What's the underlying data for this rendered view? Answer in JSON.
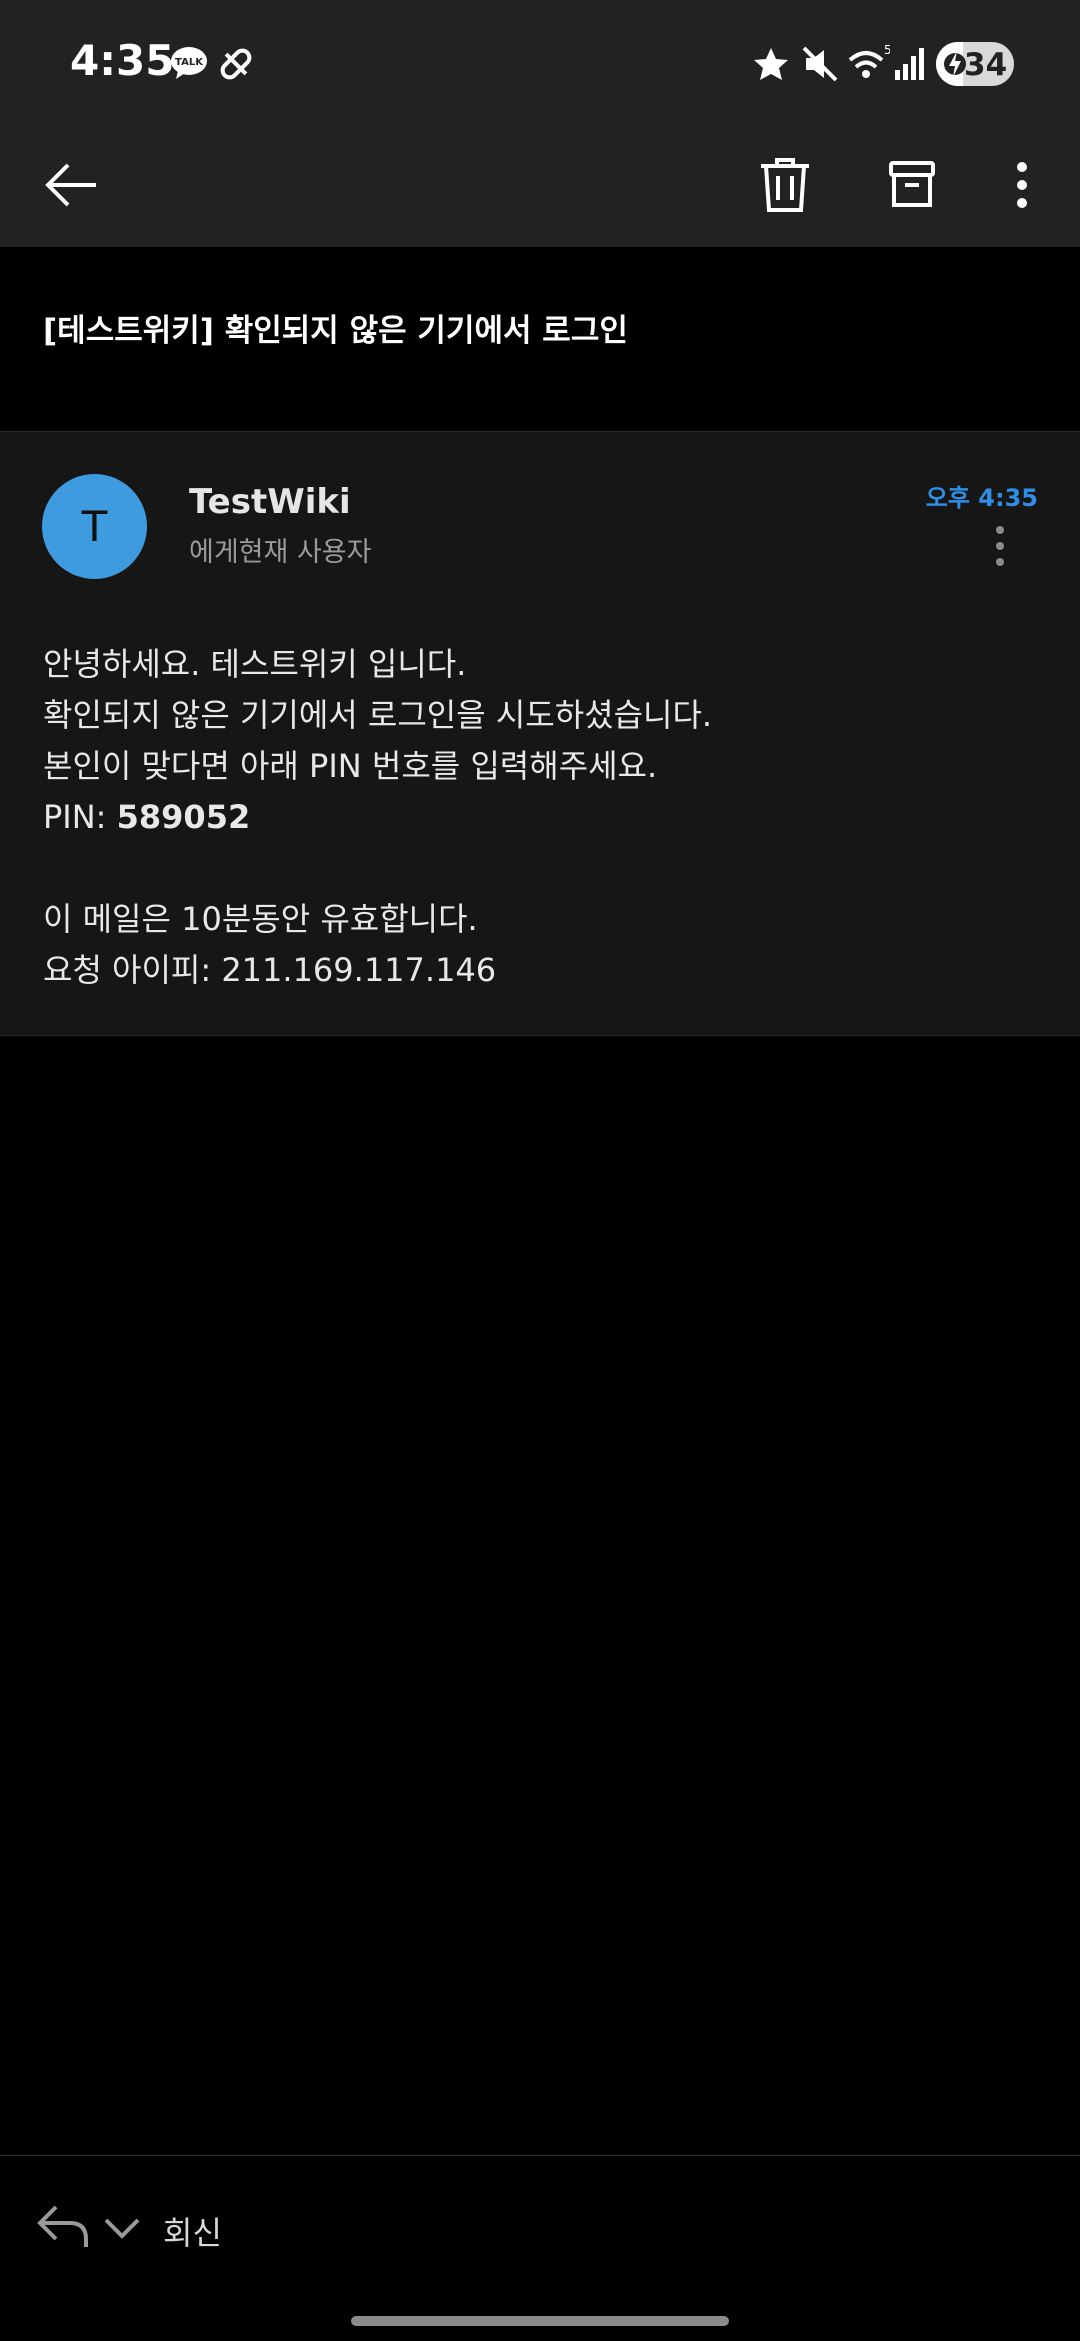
{
  "status_bar": {
    "time": "4:35",
    "notification_icons": [
      "talk-icon",
      "pill-icon"
    ],
    "system_icons": [
      "star-icon",
      "mute-icon",
      "wifi-icon",
      "signal-icon"
    ],
    "battery_percent": "34",
    "charging": true
  },
  "toolbar": {
    "icons": [
      "back-arrow-icon",
      "trash-icon",
      "archive-icon",
      "more-vertical-icon"
    ]
  },
  "email": {
    "subject": "[테스트위키] 확인되지 않은 기기에서 로그인",
    "avatar_letter": "T",
    "sender_name": "TestWiki",
    "recipient": "에게현재 사용자",
    "time": "오후 4:35",
    "body": {
      "line1": "안녕하세요. 테스트위키 입니다.",
      "line2": "확인되지 않은 기기에서 로그인을 시도하셨습니다.",
      "line3": "본인이 맞다면 아래 PIN 번호를 입력해주세요.",
      "pin_label": "PIN: ",
      "pin_value": "589052",
      "line5": "이 메일은 10분동안 유효합니다.",
      "line6": "요청 아이피: 211.169.117.146"
    }
  },
  "reply_bar": {
    "label": "회신"
  },
  "colors": {
    "bar_background": "#222222",
    "card_background": "#161616",
    "avatar": "#3f9be0",
    "time_accent": "#2f8ee6"
  }
}
